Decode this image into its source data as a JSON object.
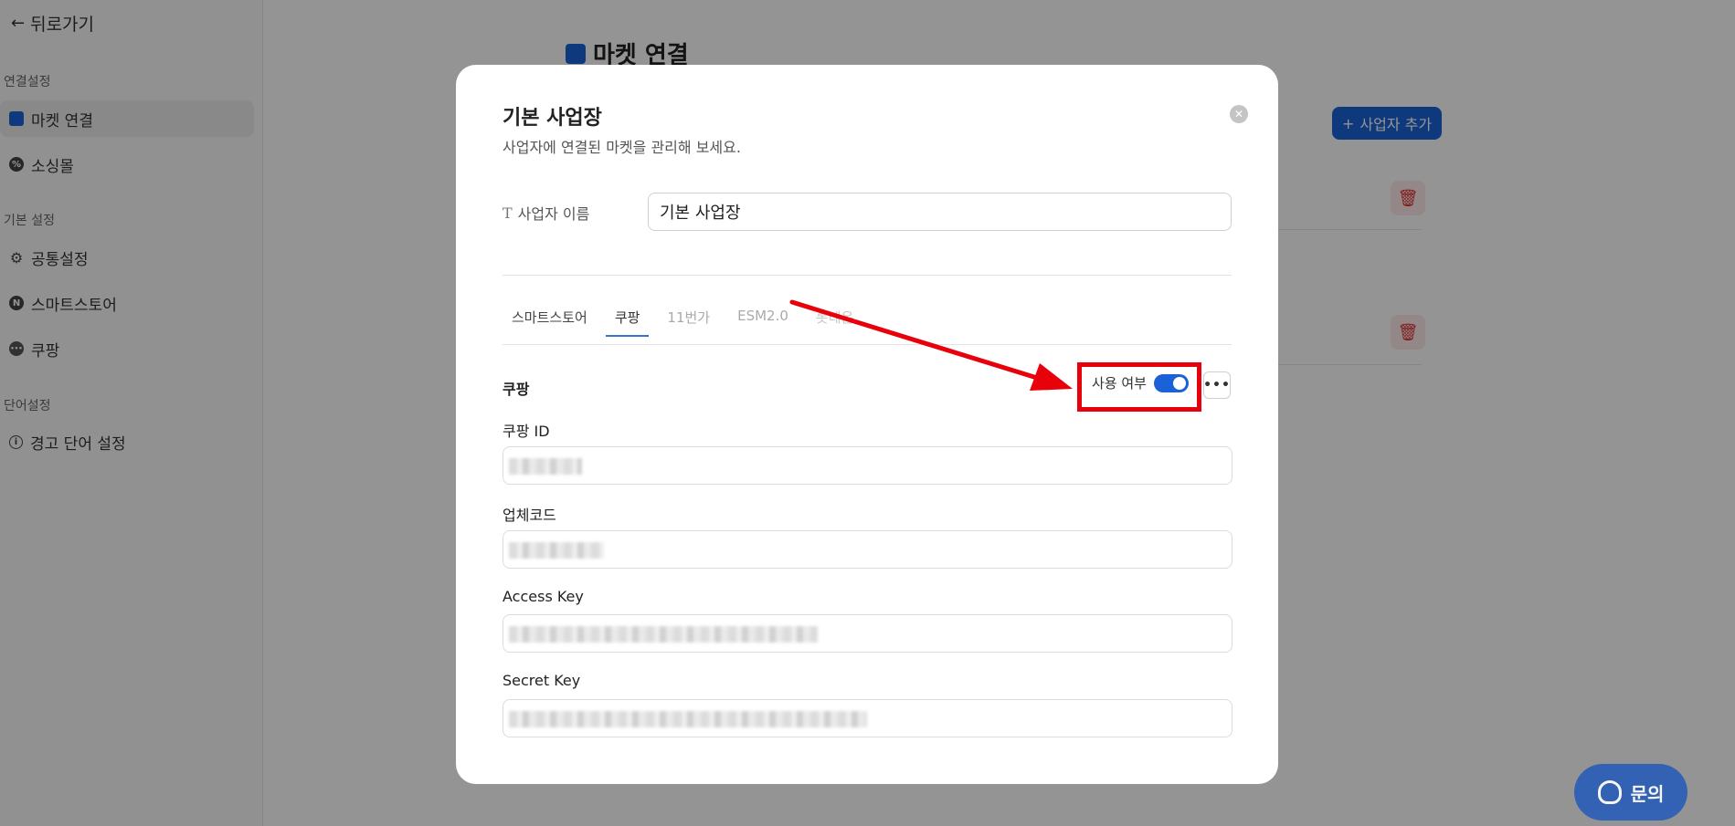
{
  "sidebar": {
    "back_label": "뒤로가기",
    "sections": [
      {
        "title": "연결설정",
        "items": [
          {
            "label": "마켓 연결",
            "icon": "store-icon",
            "active": true
          },
          {
            "label": "소싱몰",
            "icon": "sourcing-icon"
          }
        ]
      },
      {
        "title": "기본 설정",
        "items": [
          {
            "label": "공통설정",
            "icon": "gear-icon"
          },
          {
            "label": "스마트스토어",
            "icon": "naver-icon"
          },
          {
            "label": "쿠팡",
            "icon": "coupang-icon"
          }
        ]
      },
      {
        "title": "단어설정",
        "items": [
          {
            "label": "경고 단어 설정",
            "icon": "info-icon"
          }
        ]
      }
    ]
  },
  "main": {
    "title": "마켓 연결",
    "add_button": "사업자 추가"
  },
  "modal": {
    "title": "기본 사업장",
    "subtitle": "사업자에 연결된 마켓을 관리해 보세요.",
    "name_label": "사업자 이름",
    "name_value": "기본 사업장",
    "tabs": [
      "스마트스토어",
      "쿠팡",
      "11번가",
      "ESM2.0",
      "롯데온"
    ],
    "active_tab": "쿠팡",
    "section_title": "쿠팡",
    "toggle_label": "사용 여부",
    "toggle_on": true,
    "more_label": "•••",
    "fields": [
      {
        "label": "쿠팡 ID"
      },
      {
        "label": "업체코드"
      },
      {
        "label": "Access Key"
      },
      {
        "label": "Secret Key"
      }
    ]
  },
  "help_button": "문의",
  "colors": {
    "accent": "#1b62d8",
    "annotation": "#e8000b"
  }
}
